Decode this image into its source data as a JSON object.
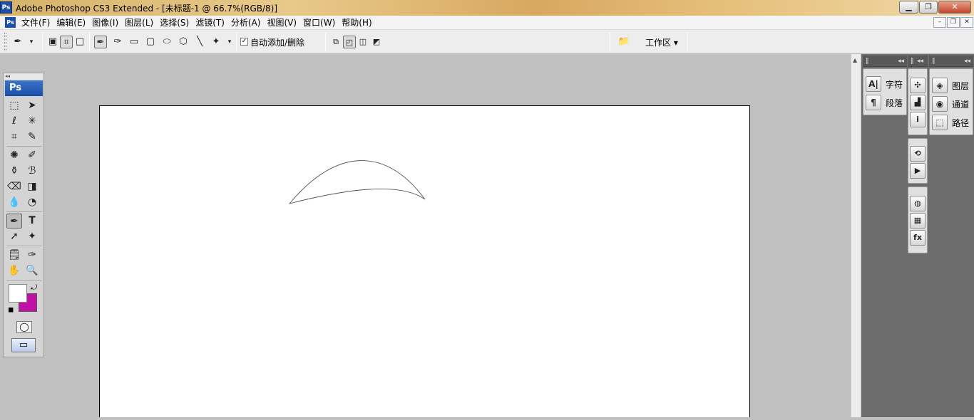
{
  "titlebar": {
    "app_icon": "Ps",
    "title": "Adobe Photoshop CS3 Extended - [未标题-1 @ 66.7%(RGB/8)]",
    "minimize": "▁",
    "restore": "❐",
    "close": "✕"
  },
  "menubar": {
    "icon": "Ps",
    "items": [
      "文件(F)",
      "编辑(E)",
      "图像(I)",
      "图层(L)",
      "选择(S)",
      "滤镜(T)",
      "分析(A)",
      "视图(V)",
      "窗口(W)",
      "帮助(H)"
    ],
    "doc_minimize": "–",
    "doc_restore": "❐",
    "doc_close": "✕"
  },
  "options_bar": {
    "auto_add_delete_label": "自动添加/删除",
    "auto_add_delete_checked": true,
    "workspace_label": "工作区 ▾"
  },
  "toolbox": {
    "badge": "Ps",
    "foreground_color": "#ffffff",
    "background_color": "#c010a8"
  },
  "panels": {
    "col1": [
      {
        "icon": "A|",
        "label": "字符"
      },
      {
        "icon": "¶",
        "label": "段落"
      }
    ],
    "col3": [
      {
        "icon": "◈",
        "label": "图层"
      },
      {
        "icon": "◉",
        "label": "通道"
      },
      {
        "icon": "⬚",
        "label": "路径"
      }
    ],
    "col2_icons": [
      "navigator-icon",
      "histogram-icon",
      "info-icon",
      "history-icon",
      "actions-icon",
      "swatches-icon",
      "grid-icon",
      "styles-icon"
    ],
    "col2_glyphs": [
      "✣",
      "▟",
      "i",
      "⟲",
      "▶",
      "◍",
      "▦",
      "fx"
    ]
  },
  "colors": {
    "canvas": "#ffffff",
    "workspace": "#c0c0c0",
    "panel_bg": "#6c6c6c",
    "path_stroke": "#555555"
  }
}
